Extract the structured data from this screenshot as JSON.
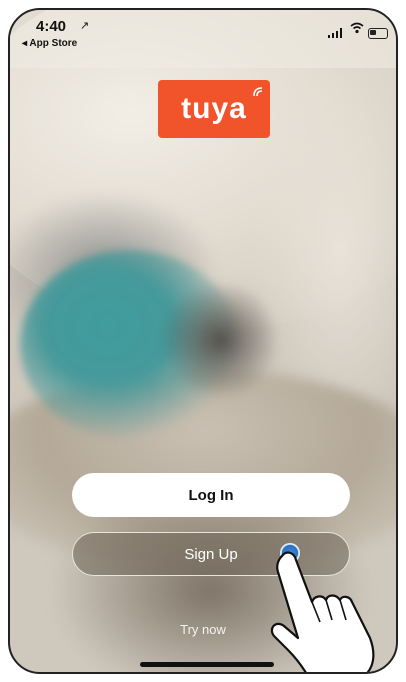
{
  "status_bar": {
    "time": "4:40",
    "location_glyph": "↗",
    "back_app": "◂ App Store",
    "wifi_glyph": "≈"
  },
  "logo": {
    "text": "tuya",
    "color": "#f1542a"
  },
  "buttons": {
    "login_label": "Log In",
    "signup_label": "Sign Up"
  },
  "try_now_label": "Try now",
  "colors": {
    "accent": "#f1542a",
    "touch": "#3b8be0"
  },
  "icons": [
    "location-arrow-icon",
    "signal-icon",
    "wifi-icon",
    "battery-icon",
    "tuya-logo",
    "hand-pointer-icon"
  ]
}
